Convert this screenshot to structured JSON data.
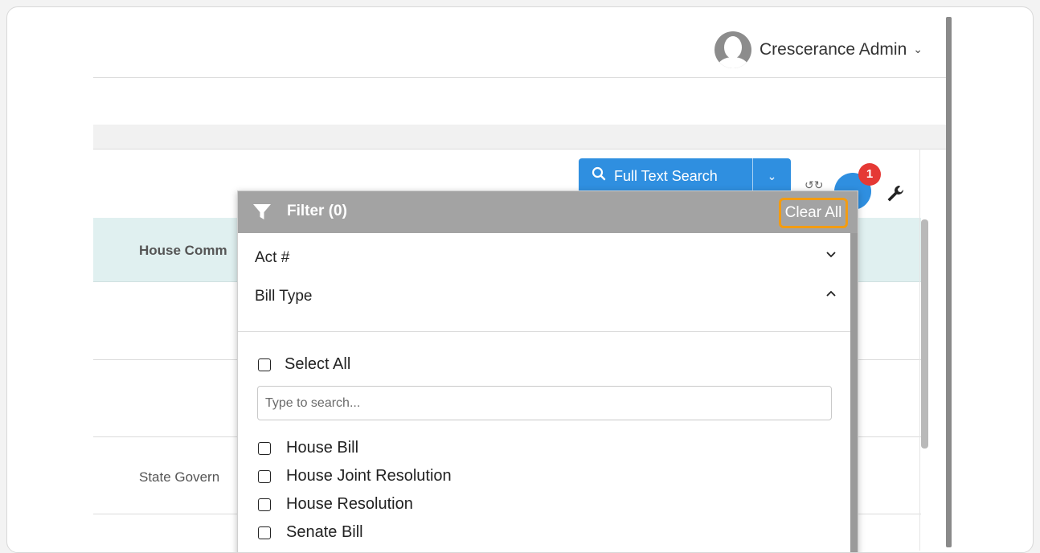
{
  "header": {
    "user_name": "Crescerance Admin",
    "user_menu_icon": "chevron-down-icon",
    "avatar_icon": "user-avatar-icon"
  },
  "toolbar": {
    "full_text_search_label": "Full Text Search",
    "search_icon": "search-icon",
    "dropdown_icon": "chevron-down-icon",
    "refresh_icon": "sync-icon",
    "filter_icon": "funnel-icon",
    "filter_badge_count": "1",
    "settings_icon": "wrench-icon"
  },
  "table": {
    "column_header": "House Comm",
    "cell_value": "State Govern"
  },
  "filter_popup": {
    "title": "Filter (0)",
    "clear_all_label": "Clear All",
    "sections": [
      {
        "label": "Act #",
        "state": "collapsed"
      },
      {
        "label": "Bill Type",
        "state": "expanded"
      }
    ],
    "select_all_label": "Select All",
    "search_placeholder": "Type to search...",
    "options": [
      {
        "label": "House Bill",
        "checked": false
      },
      {
        "label": "House Joint Resolution",
        "checked": false
      },
      {
        "label": "House Resolution",
        "checked": false
      },
      {
        "label": "Senate Bill",
        "checked": false
      }
    ]
  },
  "colors": {
    "primary": "#2f8fe0",
    "highlight": "#f39c12",
    "badge": "#e53935",
    "table_header_bg": "#e0f0f0",
    "popup_header_bg": "#a3a3a3"
  }
}
